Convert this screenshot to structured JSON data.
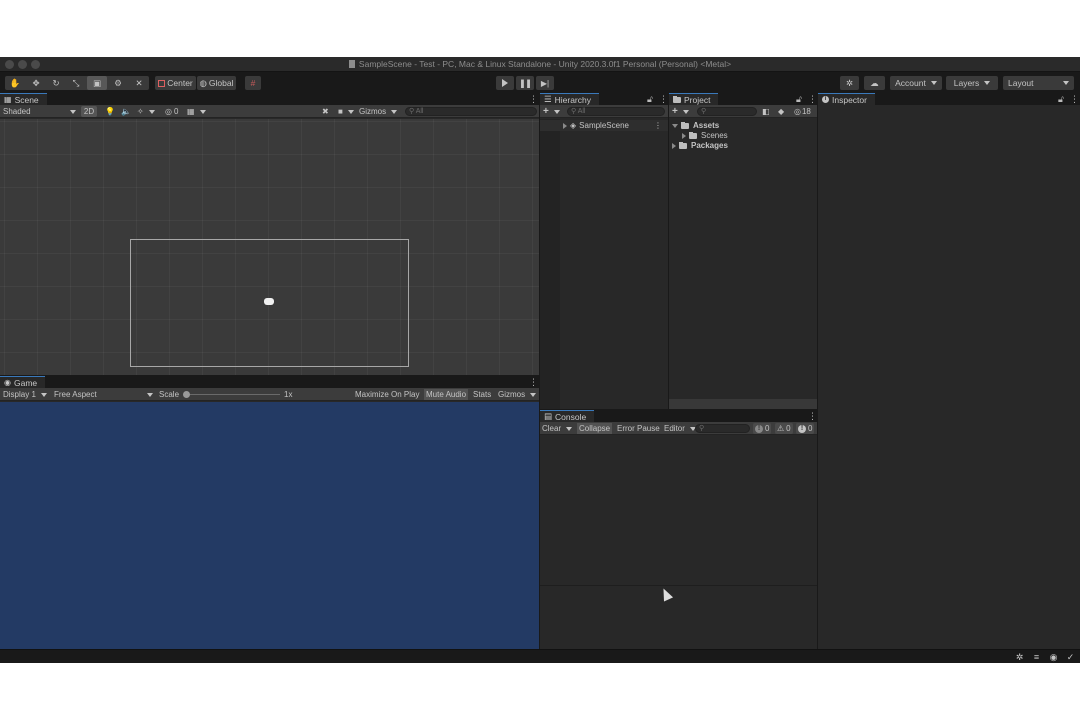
{
  "window": {
    "title": "SampleScene - Test - PC, Mac & Linux Standalone - Unity 2020.3.0f1 Personal (Personal) <Metal>"
  },
  "toolbar": {
    "tools": [
      {
        "name": "hand-tool-icon",
        "glyph": "✋"
      },
      {
        "name": "move-tool-icon",
        "glyph": "✥"
      },
      {
        "name": "rotate-tool-icon",
        "glyph": "↻"
      },
      {
        "name": "scale-tool-icon",
        "glyph": "⤡"
      },
      {
        "name": "rect-tool-icon",
        "glyph": "▣"
      },
      {
        "name": "transform-tool-icon",
        "glyph": "⚙"
      },
      {
        "name": "custom-tool-icon",
        "glyph": "✕"
      }
    ],
    "pivot_label": "Center",
    "space_label": "Global",
    "account_label": "Account",
    "layers_label": "Layers",
    "layout_label": "Layout"
  },
  "scene": {
    "tab_label": "Scene",
    "shading_label": "Shaded",
    "mode_2d_label": "2D",
    "hidden_count": "0",
    "gizmos_label": "Gizmos",
    "search_placeholder": "All"
  },
  "game": {
    "tab_label": "Game",
    "display_label": "Display 1",
    "aspect_label": "Free Aspect",
    "scale_label": "Scale",
    "scale_value": "1x",
    "maximize_label": "Maximize On Play",
    "mute_label": "Mute Audio",
    "stats_label": "Stats",
    "gizmos_label": "Gizmos"
  },
  "hierarchy": {
    "tab_label": "Hierarchy",
    "search_placeholder": "All",
    "items": [
      {
        "label": "SampleScene"
      }
    ]
  },
  "project": {
    "tab_label": "Project",
    "hidden_count": "18",
    "tree": [
      {
        "label": "Assets"
      },
      {
        "label": "Scenes"
      },
      {
        "label": "Packages"
      }
    ]
  },
  "inspector": {
    "tab_label": "Inspector"
  },
  "console": {
    "tab_label": "Console",
    "clear_label": "Clear",
    "collapse_label": "Collapse",
    "error_pause_label": "Error Pause",
    "editor_label": "Editor",
    "info_count": "0",
    "warn_count": "0",
    "error_count": "0"
  },
  "colors": {
    "game_background": "#233a64",
    "tab_accent": "#3a79bb"
  }
}
